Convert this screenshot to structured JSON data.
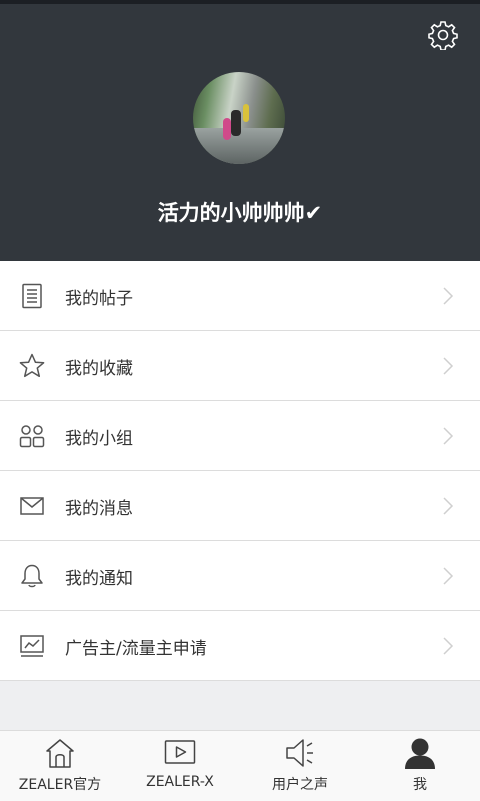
{
  "profile": {
    "username": "活力的小帅帅帅✔"
  },
  "menu": {
    "items": [
      {
        "label": "我的帖子",
        "icon": "document-icon"
      },
      {
        "label": "我的收藏",
        "icon": "star-icon"
      },
      {
        "label": "我的小组",
        "icon": "group-icon"
      },
      {
        "label": "我的消息",
        "icon": "mail-icon"
      },
      {
        "label": "我的通知",
        "icon": "bell-icon"
      },
      {
        "label": "广告主/流量主申请",
        "icon": "chart-icon"
      }
    ]
  },
  "tabs": [
    {
      "label": "ZEALER官方",
      "icon": "home-icon"
    },
    {
      "label": "ZEALER-X",
      "icon": "play-icon"
    },
    {
      "label": "用户之声",
      "icon": "speaker-icon"
    },
    {
      "label": "我",
      "icon": "person-icon",
      "active": true
    }
  ],
  "colors": {
    "header_bg": "#32373d",
    "accent_text": "#ffffff",
    "icon": "#555555"
  }
}
